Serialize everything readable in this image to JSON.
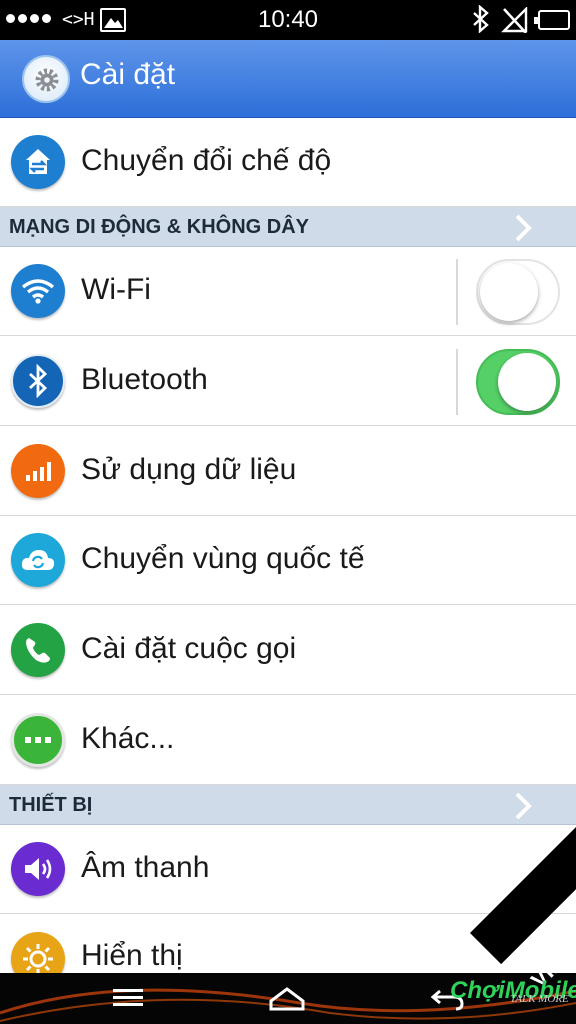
{
  "status_bar": {
    "time": "10:40",
    "left_glyph": "<>H",
    "icons": [
      "signal-dots-icon",
      "image-icon",
      "bluetooth-icon",
      "no-signal-icon",
      "battery-icon"
    ]
  },
  "action_bar": {
    "title": "Cài đặt",
    "icon": "settings-gear-icon",
    "color": "#4a86e3"
  },
  "rows": [
    {
      "label": "Chuyển đổi chế độ",
      "icon": "switch-mode-icon",
      "color": "#1e7fd0"
    },
    {
      "label": "Wi-Fi",
      "icon": "wifi-icon",
      "color": "#1e7fd0",
      "toggle": false
    },
    {
      "label": "Bluetooth",
      "icon": "bluetooth-icon",
      "color": "#1565b6",
      "toggle": true
    },
    {
      "label": "Sử dụng dữ liệu",
      "icon": "data-usage-icon",
      "color": "#f26a10"
    },
    {
      "label": "Chuyển vùng quốc tế",
      "icon": "roaming-cloud-icon",
      "color": "#1ea7d9"
    },
    {
      "label": "Cài đặt cuộc gọi",
      "icon": "phone-icon",
      "color": "#23a343"
    },
    {
      "label": "Khác...",
      "icon": "more-dots-icon",
      "color": "#3ab53a"
    },
    {
      "label": "Âm thanh",
      "icon": "speaker-icon",
      "color": "#6a2bd1"
    },
    {
      "label": "Hiển thị",
      "icon": "brightness-icon",
      "color": "#e8a417"
    }
  ],
  "sections": [
    {
      "label": "MẠNG DI ĐỘNG & KHÔNG DÂY"
    },
    {
      "label": "THIẾT BỊ"
    }
  ],
  "toggle_colors": {
    "on": "#55d066",
    "off": "#ffffff"
  },
  "nav_bar": {
    "buttons": [
      "menu-icon",
      "home-icon",
      "back-icon"
    ]
  },
  "watermark": {
    "brand": "ChợiMobile",
    "tagline": "TALK MORE",
    "site": "VIET.COM"
  }
}
